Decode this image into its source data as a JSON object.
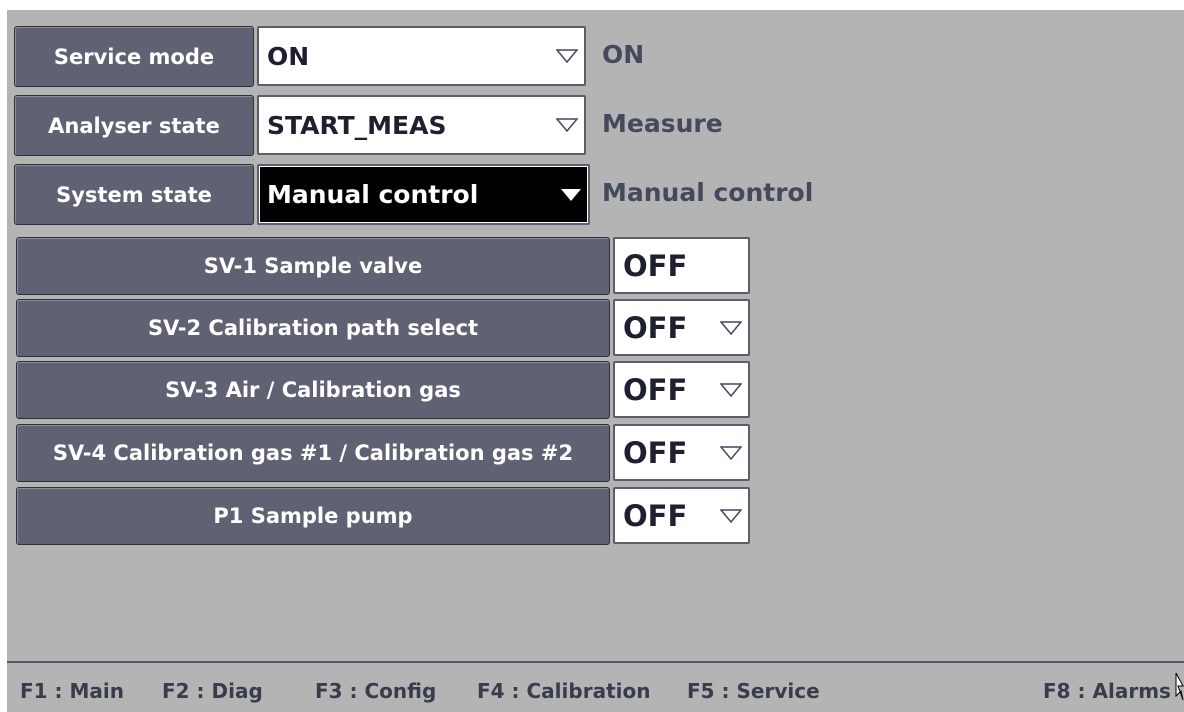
{
  "controls": [
    {
      "label": "Service mode",
      "value": "ON",
      "status": "ON",
      "style": "light"
    },
    {
      "label": "Analyser state",
      "value": "START_MEAS",
      "status": "Measure",
      "style": "light"
    },
    {
      "label": "System state",
      "value": "Manual control",
      "status": "Manual control",
      "style": "dark"
    }
  ],
  "devices": [
    {
      "label": "SV-1 Sample valve",
      "state": "OFF",
      "has_dropdown": false
    },
    {
      "label": "SV-2  Calibration path select",
      "state": "OFF",
      "has_dropdown": true
    },
    {
      "label": "SV-3 Air / Calibration gas",
      "state": "OFF",
      "has_dropdown": true
    },
    {
      "label": "SV-4 Calibration gas #1  / Calibration gas #2",
      "state": "OFF",
      "has_dropdown": true
    },
    {
      "label": "P1 Sample pump",
      "state": "OFF",
      "has_dropdown": true
    }
  ],
  "footer": {
    "keys": [
      "F1 : Main",
      "F2 : Diag",
      "F3 : Config",
      "F4 : Calibration",
      "F5 : Service",
      "F8 : Alarms"
    ]
  },
  "colors": {
    "background": "#b4b4b4",
    "button": "#5f6272",
    "text_dark": "#44495c"
  }
}
